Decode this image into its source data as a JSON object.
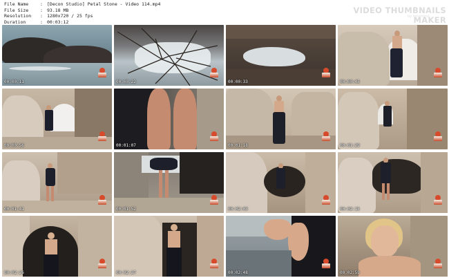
{
  "info": {
    "rows": [
      {
        "label": "File Name",
        "value": "[Decon Studio] Petal Stone - Video 114.mp4"
      },
      {
        "label": "File Size",
        "value": "93.18 MB"
      },
      {
        "label": "Resolution",
        "value": "1280x720 / 25 fps"
      },
      {
        "label": "Duration",
        "value": "00:03:12"
      }
    ],
    "separator": ":"
  },
  "branding": {
    "title": "VIDEO THUMBNAILS MAKER",
    "subtitle": "by Innomind"
  },
  "thumbnails": [
    {
      "time": "00:00:11"
    },
    {
      "time": "00:00:22"
    },
    {
      "time": "00:00:33"
    },
    {
      "time": "00:00:45"
    },
    {
      "time": "00:00:56"
    },
    {
      "time": "00:01:07"
    },
    {
      "time": "00:01:18"
    },
    {
      "time": "00:01:29"
    },
    {
      "time": "00:01:41"
    },
    {
      "time": "00:01:52"
    },
    {
      "time": "00:02:03"
    },
    {
      "time": "00:02:15"
    },
    {
      "time": "00:02:26"
    },
    {
      "time": "00:02:37"
    },
    {
      "time": "00:02:48"
    },
    {
      "time": "00:02:59"
    }
  ]
}
